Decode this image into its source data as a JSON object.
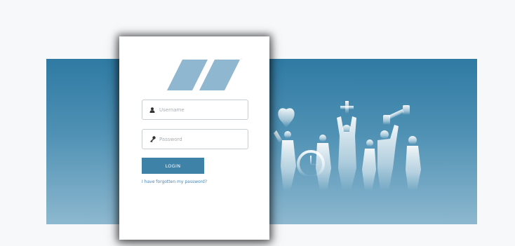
{
  "login": {
    "username_placeholder": "Username",
    "password_placeholder": "Password",
    "login_label": "LOGIN",
    "forgot_link": "I have forgotten my password?",
    "trademark": "™"
  },
  "colors": {
    "accent": "#3f82a8",
    "banner_top": "#2f7aa3",
    "banner_bottom": "#8db8cf",
    "logo": "#8fb7cf",
    "link": "#4a85b3"
  },
  "icons": {
    "logo": "parallelogram-logo",
    "username": "user-icon",
    "password": "key-icon",
    "banner": "activity-people-illustration"
  }
}
